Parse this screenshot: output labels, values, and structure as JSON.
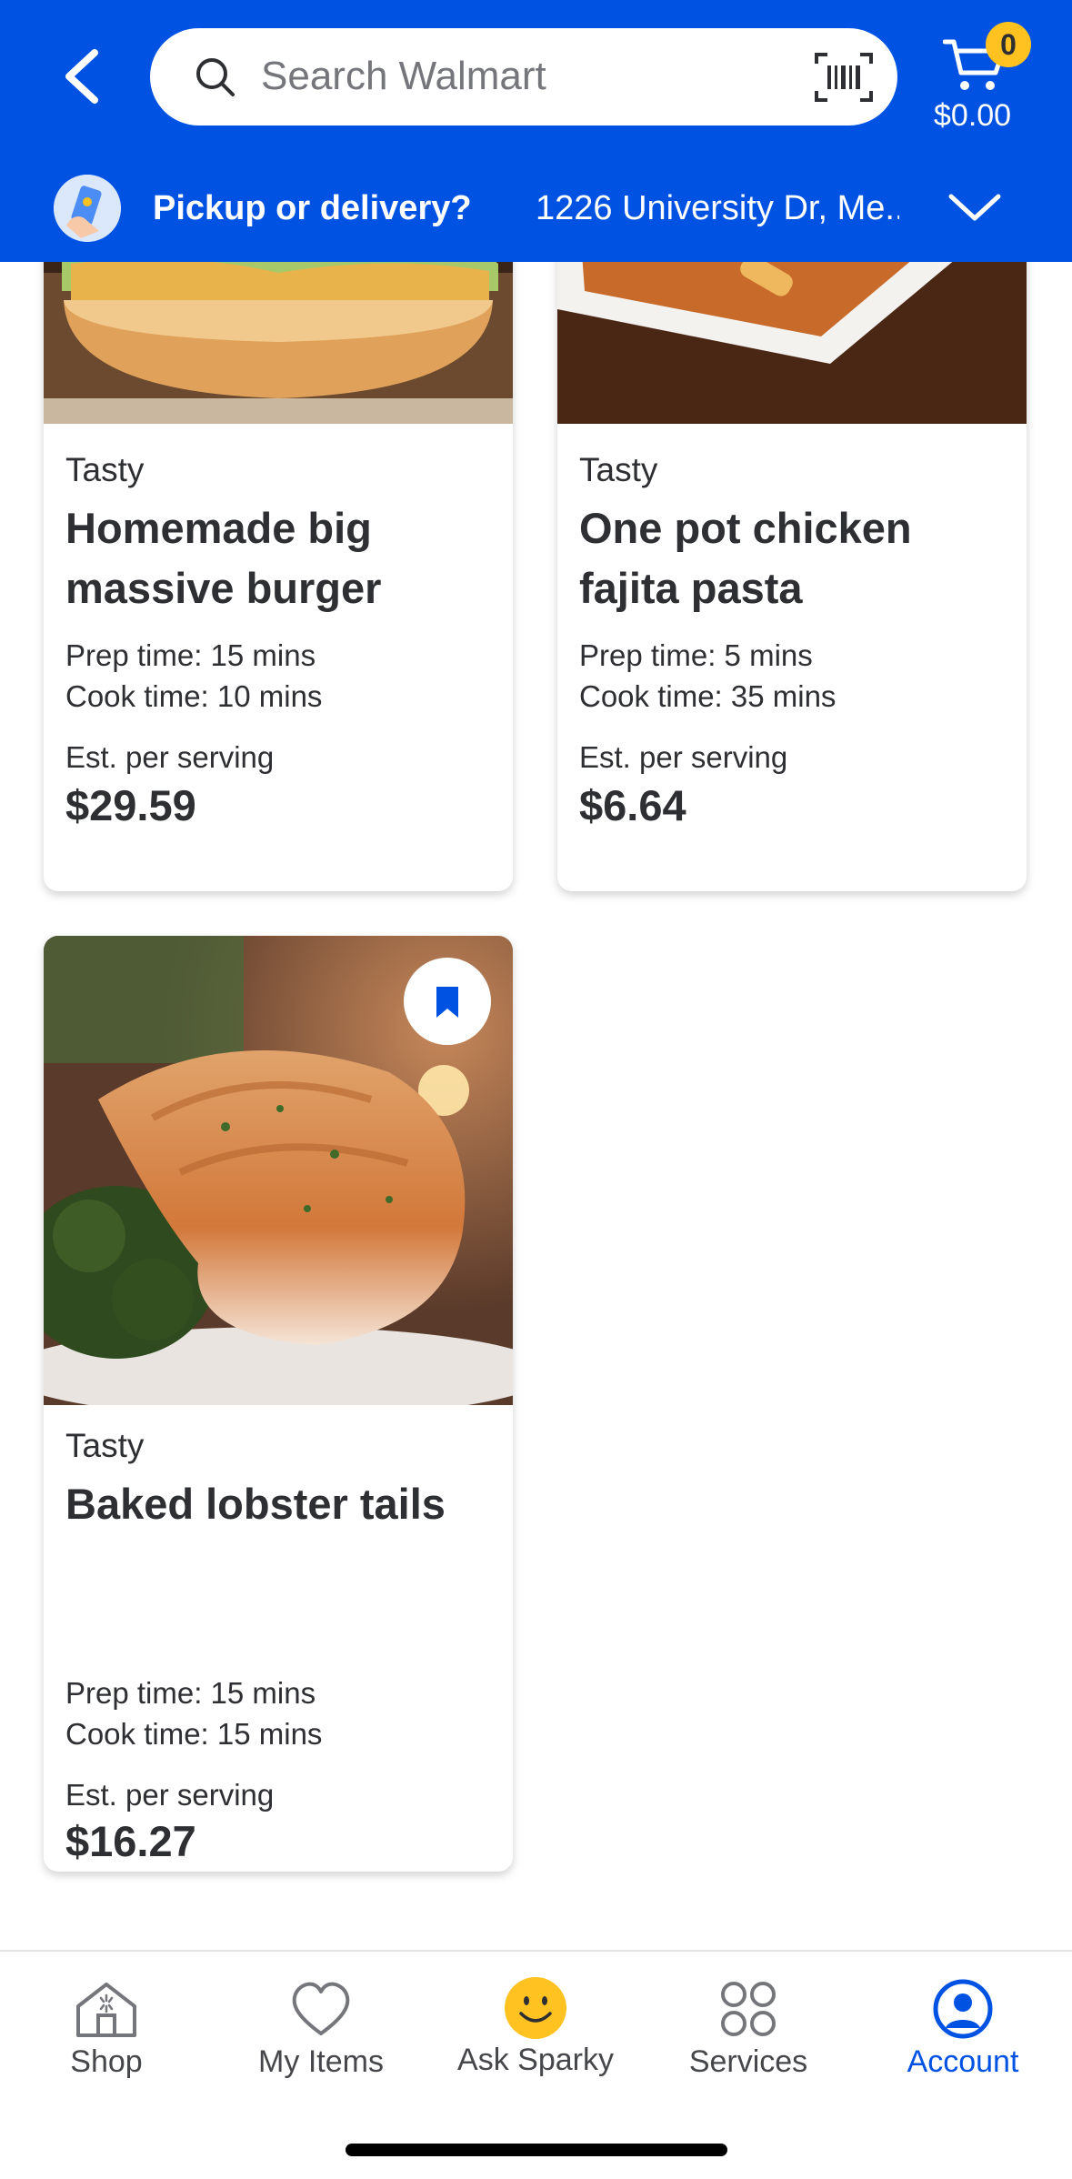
{
  "header": {
    "search_placeholder": "Search Walmart",
    "cart_count": "0",
    "cart_total": "$0.00",
    "pickup_label": "Pickup or delivery?",
    "address": "1226 University Dr, Me..."
  },
  "colors": {
    "brand_blue": "#0053e2",
    "badge_yellow": "#ffc220",
    "text_dark": "#2e2f32"
  },
  "recipes": [
    {
      "source": "Tasty",
      "title_line1": "Homemade big",
      "title_line2": "massive burger",
      "prep": "Prep time: 15 mins",
      "cook": "Cook time: 10 mins",
      "est_label": "Est. per serving",
      "price": "$29.59"
    },
    {
      "source": "Tasty",
      "title_line1": "One pot chicken",
      "title_line2": "fajita pasta",
      "prep": "Prep time: 5 mins",
      "cook": "Cook time: 35 mins",
      "est_label": "Est. per serving",
      "price": "$6.64"
    },
    {
      "source": "Tasty",
      "title_line1": "Baked lobster tails",
      "title_line2": "",
      "prep": "Prep time: 15 mins",
      "cook": "Cook time: 15 mins",
      "est_label": "Est. per serving",
      "price": "$16.27"
    }
  ],
  "nav": {
    "shop": "Shop",
    "my_items": "My Items",
    "ask_sparky": "Ask Sparky",
    "services": "Services",
    "account": "Account",
    "active": "Account"
  }
}
